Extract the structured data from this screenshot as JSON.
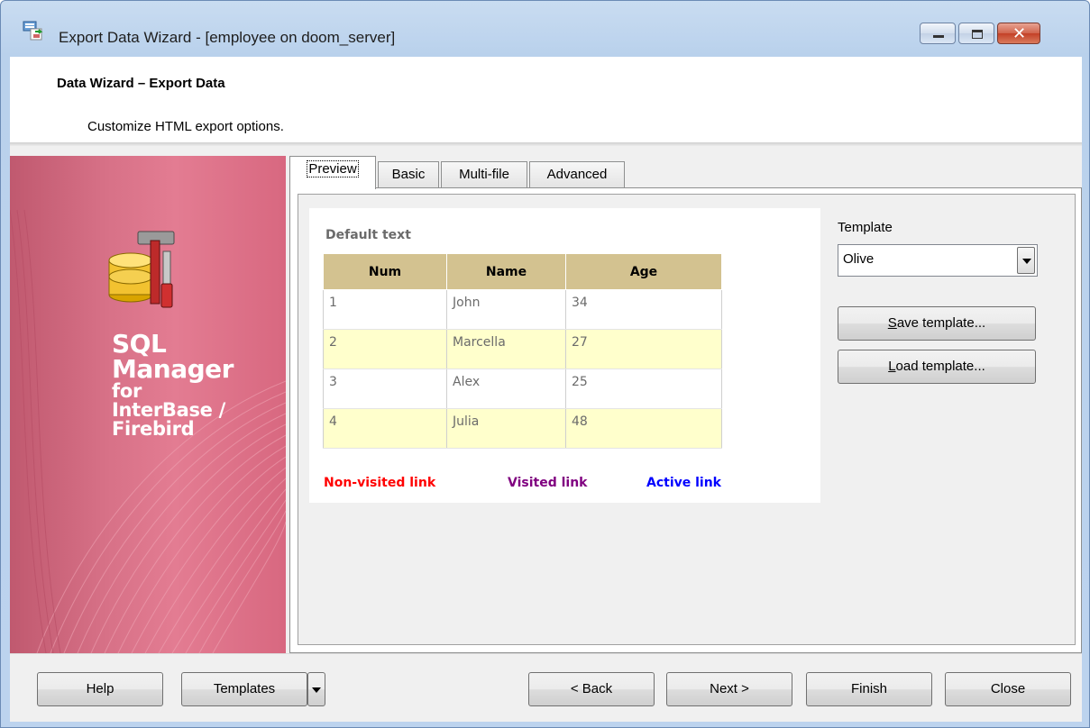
{
  "window": {
    "title": "Export Data Wizard - [employee on doom_server]",
    "icon": "export-data-icon"
  },
  "header": {
    "title": "Data Wizard – Export Data",
    "subtitle": "Customize HTML export options."
  },
  "banner": {
    "line1": "SQL",
    "line2": "Manager",
    "line3": "for",
    "line4": "InterBase /",
    "line5": "Firebird",
    "icon": "database-tools-icon"
  },
  "tabs": [
    {
      "label": "Preview",
      "active": true
    },
    {
      "label": "Basic",
      "active": false
    },
    {
      "label": "Multi-file",
      "active": false
    },
    {
      "label": "Advanced",
      "active": false
    }
  ],
  "preview": {
    "default_text": "Default text",
    "columns": [
      "Num",
      "Name",
      "Age"
    ],
    "rows": [
      [
        "1",
        "John",
        "34"
      ],
      [
        "2",
        "Marcella",
        "27"
      ],
      [
        "3",
        "Alex",
        "25"
      ],
      [
        "4",
        "Julia",
        "48"
      ]
    ],
    "links": {
      "non_visited": "Non-visited link",
      "visited": "Visited link",
      "active": "Active link"
    },
    "colors": {
      "header_bg": "#d3c290",
      "alt_row_bg": "#ffffcc",
      "non_visited": "#ff0000",
      "visited": "#800080",
      "active": "#0000ff"
    }
  },
  "template": {
    "label": "Template",
    "selected": "Olive",
    "save_label": "Save template...",
    "load_label": "Load template..."
  },
  "buttons": {
    "help": "Help",
    "templates": "Templates",
    "back": "< Back",
    "next": "Next >",
    "finish": "Finish",
    "close": "Close"
  }
}
